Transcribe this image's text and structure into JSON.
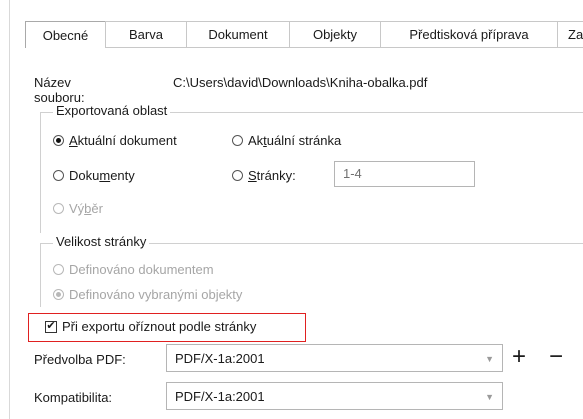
{
  "tabs": [
    {
      "label": "Obecné",
      "active": true
    },
    {
      "label": "Barva"
    },
    {
      "label": "Dokument"
    },
    {
      "label": "Objekty"
    },
    {
      "label": "Předtisková příprava"
    },
    {
      "label": "Za"
    }
  ],
  "file": {
    "label": "Název souboru:",
    "path": "C:\\Users\\david\\Downloads\\Kniha-obalka.pdf"
  },
  "export_area": {
    "legend": "Exportovaná oblast",
    "options": {
      "current_document": {
        "pre": "",
        "ul": "A",
        "post": "ktuální dokument",
        "checked": true
      },
      "current_page": {
        "pre": "Ak",
        "ul": "t",
        "post": "uální stránka"
      },
      "documents": {
        "pre": "Doku",
        "ul": "m",
        "post": "enty"
      },
      "pages": {
        "pre": "",
        "ul": "S",
        "post": "tránky:"
      },
      "selection": {
        "pre": "Vý",
        "ul": "b",
        "post": "ěr",
        "disabled": true
      }
    },
    "pages_value": "1-4"
  },
  "page_size": {
    "legend": "Velikost stránky",
    "opt1": "Definováno dokumentem",
    "opt2": "Definováno vybranými objekty"
  },
  "crop": {
    "label": "Při exportu oříznout podle stránky",
    "checked": true,
    "check_glyph": "✔"
  },
  "preset": {
    "label": "Předvolba PDF:",
    "value": "PDF/X-1a:2001",
    "plus": "+",
    "minus": "−"
  },
  "compat": {
    "label": "Kompatibilita:",
    "value": "PDF/X-1a:2001"
  },
  "glyphs": {
    "dropdown": "▼"
  },
  "colors": {
    "highlight": "#e02020"
  }
}
